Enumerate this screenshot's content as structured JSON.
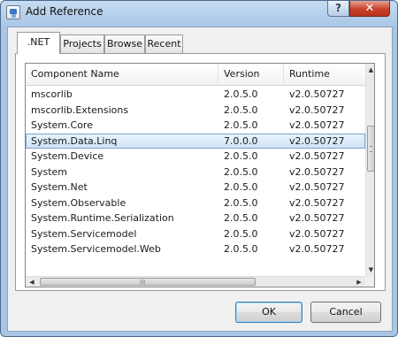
{
  "window": {
    "title": "Add Reference",
    "help_label": "?",
    "close_label": "✕"
  },
  "tabs": [
    {
      "label": ".NET",
      "active": true
    },
    {
      "label": "Projects",
      "active": false
    },
    {
      "label": "Browse",
      "active": false
    },
    {
      "label": "Recent",
      "active": false
    }
  ],
  "table": {
    "columns": [
      "Component Name",
      "Version",
      "Runtime"
    ],
    "rows": [
      {
        "name": "mscorlib",
        "version": "2.0.5.0",
        "runtime": "v2.0.50727"
      },
      {
        "name": "mscorlib.Extensions",
        "version": "2.0.5.0",
        "runtime": "v2.0.50727"
      },
      {
        "name": "System.Core",
        "version": "2.0.5.0",
        "runtime": "v2.0.50727"
      },
      {
        "name": "System.Data.Linq",
        "version": "7.0.0.0",
        "runtime": "v2.0.50727",
        "selected": true
      },
      {
        "name": "System.Device",
        "version": "2.0.5.0",
        "runtime": "v2.0.50727"
      },
      {
        "name": "System",
        "version": "2.0.5.0",
        "runtime": "v2.0.50727"
      },
      {
        "name": "System.Net",
        "version": "2.0.5.0",
        "runtime": "v2.0.50727"
      },
      {
        "name": "System.Observable",
        "version": "2.0.5.0",
        "runtime": "v2.0.50727"
      },
      {
        "name": "System.Runtime.Serialization",
        "version": "2.0.5.0",
        "runtime": "v2.0.50727"
      },
      {
        "name": "System.Servicemodel",
        "version": "2.0.5.0",
        "runtime": "v2.0.50727"
      },
      {
        "name": "System.Servicemodel.Web",
        "version": "2.0.5.0",
        "runtime": "v2.0.50727"
      }
    ]
  },
  "scrollbars": {
    "up_arrow": "▲",
    "down_arrow": "▼",
    "left_arrow": "◀",
    "right_arrow": "▶",
    "h_grip": "III"
  },
  "buttons": {
    "ok": "OK",
    "cancel": "Cancel"
  },
  "colors": {
    "title_gradient_top": "#c6dcf1",
    "selection_border": "#7da2ce",
    "close_red": "#c8412a"
  },
  "icons": {
    "app": "add-reference-icon",
    "help": "help-icon",
    "close": "close-icon"
  }
}
